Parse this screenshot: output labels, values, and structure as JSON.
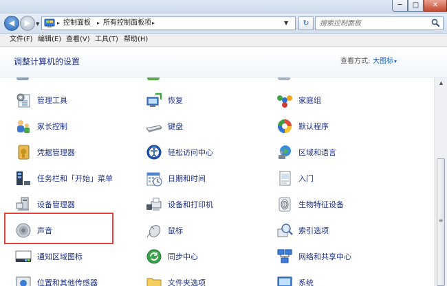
{
  "window": {
    "min_glyph": "─",
    "max_glyph": "□",
    "close_glyph": "✕"
  },
  "navigation": {
    "back_glyph": "◀",
    "forward_glyph": "▶",
    "breadcrumb": [
      "控制面板",
      "所有控制面板项"
    ],
    "separator": "▸",
    "search_placeholder": "搜索控制面板"
  },
  "menu": [
    {
      "label": "文件(F)"
    },
    {
      "label": "编辑(E)"
    },
    {
      "label": "查看(V)"
    },
    {
      "label": "工具(T)"
    },
    {
      "label": "帮助(H)"
    }
  ],
  "header": {
    "title": "调整计算机的设置",
    "view_by_label": "查看方式:",
    "view_by_value": "大图标",
    "view_by_arrow": "▾"
  },
  "items": [
    {
      "label": "管理工具",
      "icon": "admin-tools-icon"
    },
    {
      "label": "恢复",
      "icon": "recovery-icon"
    },
    {
      "label": "家庭组",
      "icon": "homegroup-icon"
    },
    {
      "label": "家长控制",
      "icon": "parental-controls-icon"
    },
    {
      "label": "键盘",
      "icon": "keyboard-icon"
    },
    {
      "label": "默认程序",
      "icon": "default-programs-icon"
    },
    {
      "label": "凭据管理器",
      "icon": "credential-manager-icon"
    },
    {
      "label": "轻松访问中心",
      "icon": "ease-of-access-icon"
    },
    {
      "label": "区域和语言",
      "icon": "region-language-icon"
    },
    {
      "label": "任务栏和「开始」菜单",
      "icon": "taskbar-icon"
    },
    {
      "label": "日期和时间",
      "icon": "date-time-icon"
    },
    {
      "label": "入门",
      "icon": "getting-started-icon"
    },
    {
      "label": "设备管理器",
      "icon": "device-manager-icon"
    },
    {
      "label": "设备和打印机",
      "icon": "devices-printers-icon"
    },
    {
      "label": "生物特征设备",
      "icon": "biometric-icon"
    },
    {
      "label": "声音",
      "icon": "sound-icon"
    },
    {
      "label": "鼠标",
      "icon": "mouse-icon"
    },
    {
      "label": "索引选项",
      "icon": "indexing-icon"
    },
    {
      "label": "通知区域图标",
      "icon": "notification-area-icon"
    },
    {
      "label": "同步中心",
      "icon": "sync-center-icon"
    },
    {
      "label": "网络和共享中心",
      "icon": "network-sharing-icon"
    },
    {
      "label": "位置和其他传感器",
      "icon": "location-sensors-icon"
    },
    {
      "label": "文件夹选项",
      "icon": "folder-options-icon"
    },
    {
      "label": "系统",
      "icon": "system-icon"
    }
  ],
  "highlighted_item": "声音",
  "scrollbar": {
    "up_glyph": "▲",
    "down_glyph": "▼",
    "grip": "≡"
  }
}
